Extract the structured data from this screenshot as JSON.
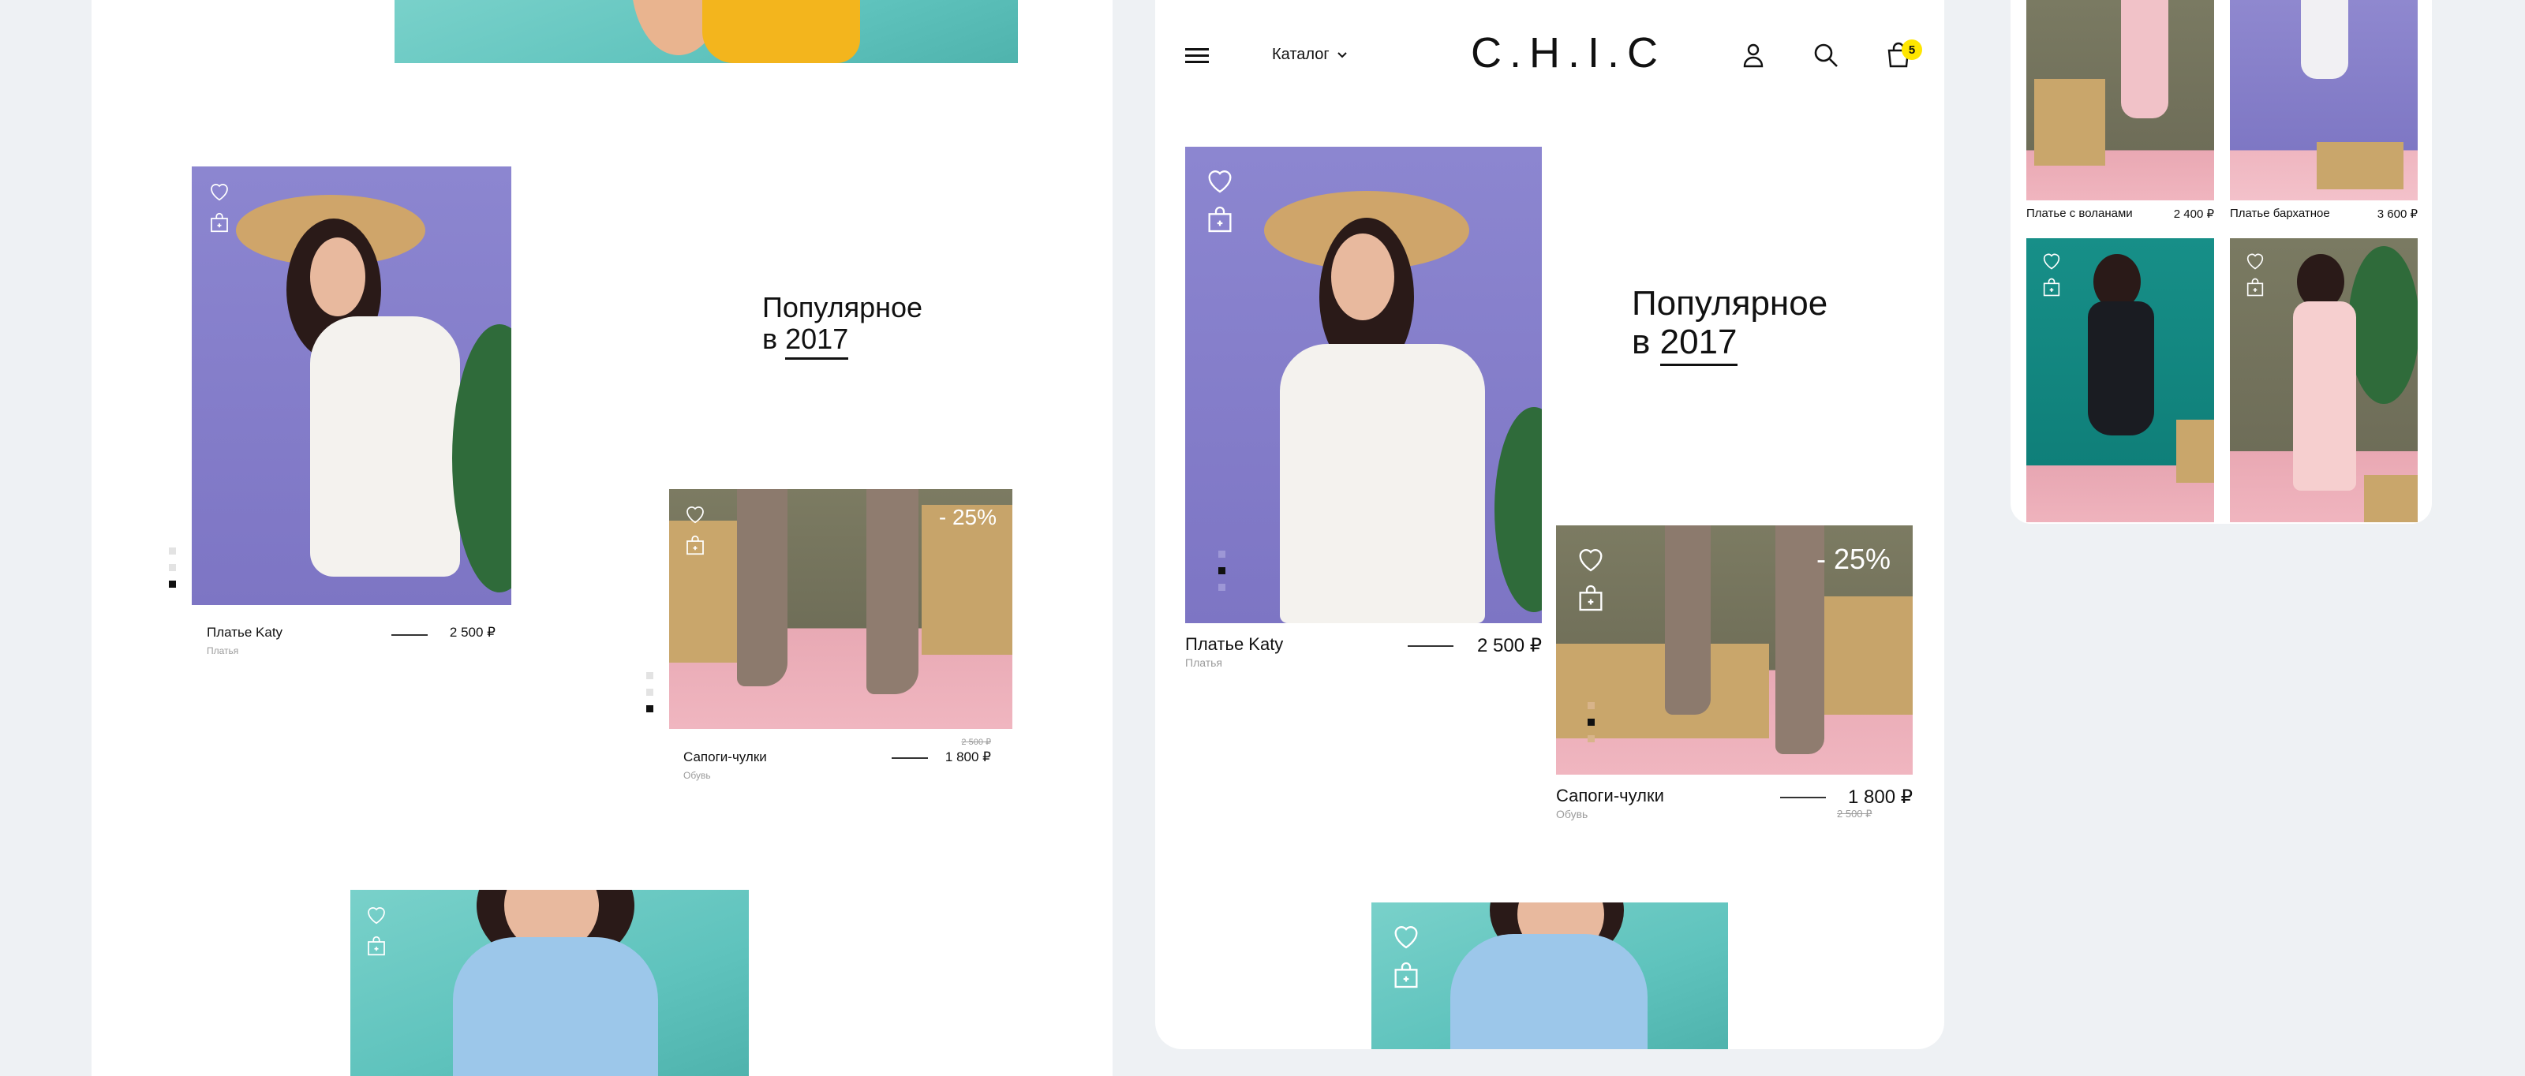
{
  "desktop": {
    "heading": {
      "line1": "Популярное",
      "prefix": "в",
      "year": "2017"
    },
    "products": [
      {
        "name": "Платье Katy",
        "category": "Платья",
        "price": "2 500 ₽"
      },
      {
        "name": "Сапоги-чулки",
        "category": "Обувь",
        "price": "1 800 ₽",
        "old_price": "2 500 ₽",
        "discount": "- 25%"
      }
    ]
  },
  "tablet": {
    "header": {
      "logo": "C.H.I.C",
      "catalog_label": "Каталог",
      "cart_count": "5",
      "icons": [
        "menu-icon",
        "user-icon",
        "search-icon",
        "cart-icon"
      ]
    },
    "heading": {
      "line1": "Популярное",
      "prefix": "в",
      "year": "2017"
    },
    "products": [
      {
        "name": "Платье Katy",
        "category": "Платья",
        "price": "2 500 ₽"
      },
      {
        "name": "Сапоги-чулки",
        "category": "Обувь",
        "price": "1 800 ₽",
        "old_price": "2 500 ₽",
        "discount": "- 25%"
      }
    ]
  },
  "mobile": {
    "products": [
      {
        "name": "Платье с воланами",
        "price": "2 400 ₽"
      },
      {
        "name": "Платье бархатное",
        "price": "3 600 ₽"
      }
    ]
  },
  "colors": {
    "page_bg": "#eef1f4",
    "accent": "#ffe600",
    "text": "#111111",
    "muted": "#9b9b9b"
  }
}
